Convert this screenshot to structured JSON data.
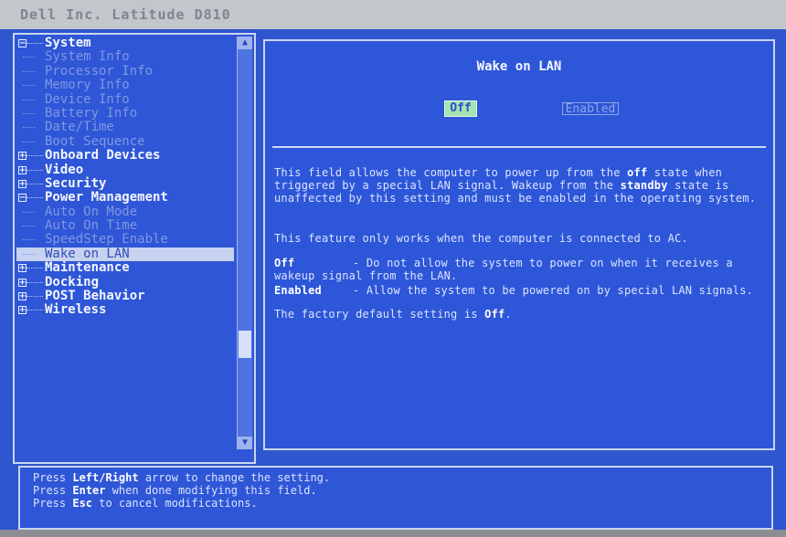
{
  "window": {
    "title": "Dell Inc. Latitude D810"
  },
  "tree": {
    "items": [
      {
        "label": "System",
        "kind": "parent",
        "expanded": true
      },
      {
        "label": "System Info",
        "kind": "child"
      },
      {
        "label": "Processor Info",
        "kind": "child"
      },
      {
        "label": "Memory Info",
        "kind": "child"
      },
      {
        "label": "Device Info",
        "kind": "child"
      },
      {
        "label": "Battery Info",
        "kind": "child"
      },
      {
        "label": "Date/Time",
        "kind": "child"
      },
      {
        "label": "Boot Sequence",
        "kind": "child"
      },
      {
        "label": "Onboard Devices",
        "kind": "parent",
        "expanded": false
      },
      {
        "label": "Video",
        "kind": "parent",
        "expanded": false
      },
      {
        "label": "Security",
        "kind": "parent",
        "expanded": false
      },
      {
        "label": "Power Management",
        "kind": "parent",
        "expanded": true
      },
      {
        "label": "Auto On Mode",
        "kind": "child"
      },
      {
        "label": "Auto On Time",
        "kind": "child"
      },
      {
        "label": "SpeedStep Enable",
        "kind": "child"
      },
      {
        "label": "Wake on LAN",
        "kind": "child",
        "selected": true
      },
      {
        "label": "Maintenance",
        "kind": "parent",
        "expanded": false
      },
      {
        "label": "Docking",
        "kind": "parent",
        "expanded": false
      },
      {
        "label": "POST Behavior",
        "kind": "parent",
        "expanded": false
      },
      {
        "label": "Wireless",
        "kind": "parent",
        "expanded": false
      }
    ]
  },
  "detail": {
    "title": "Wake on LAN",
    "options": {
      "off": "Off",
      "enabled": "Enabled",
      "selected": "Off"
    },
    "desc_main_part1": "This field allows the computer to power up from the ",
    "desc_main_kw1": "off",
    "desc_main_part2": " state when triggered by a special LAN signal. Wakeup from the ",
    "desc_main_kw2": "standby",
    "desc_main_part3": " state is unaffected by this setting and must be enabled in the operating system.",
    "desc_ac": "This feature only works when the computer is connected to AC.",
    "off_term": "Off",
    "off_desc": "- Do not allow the system to power on when it receives a wakeup signal from the LAN.",
    "enabled_term": "Enabled",
    "enabled_desc": "- Allow the system to be powered on by special LAN signals.",
    "default_prefix": "The factory default setting is ",
    "default_value": "Off",
    "default_suffix": "."
  },
  "help": {
    "line1_pre": "Press ",
    "line1_key": "Left/Right",
    "line1_post": " arrow to change the setting.",
    "line2_pre": "Press ",
    "line2_key": "Enter",
    "line2_post": " when done modifying this field.",
    "line3_pre": "Press ",
    "line3_key": "Esc",
    "line3_post": " to cancel modifications."
  }
}
